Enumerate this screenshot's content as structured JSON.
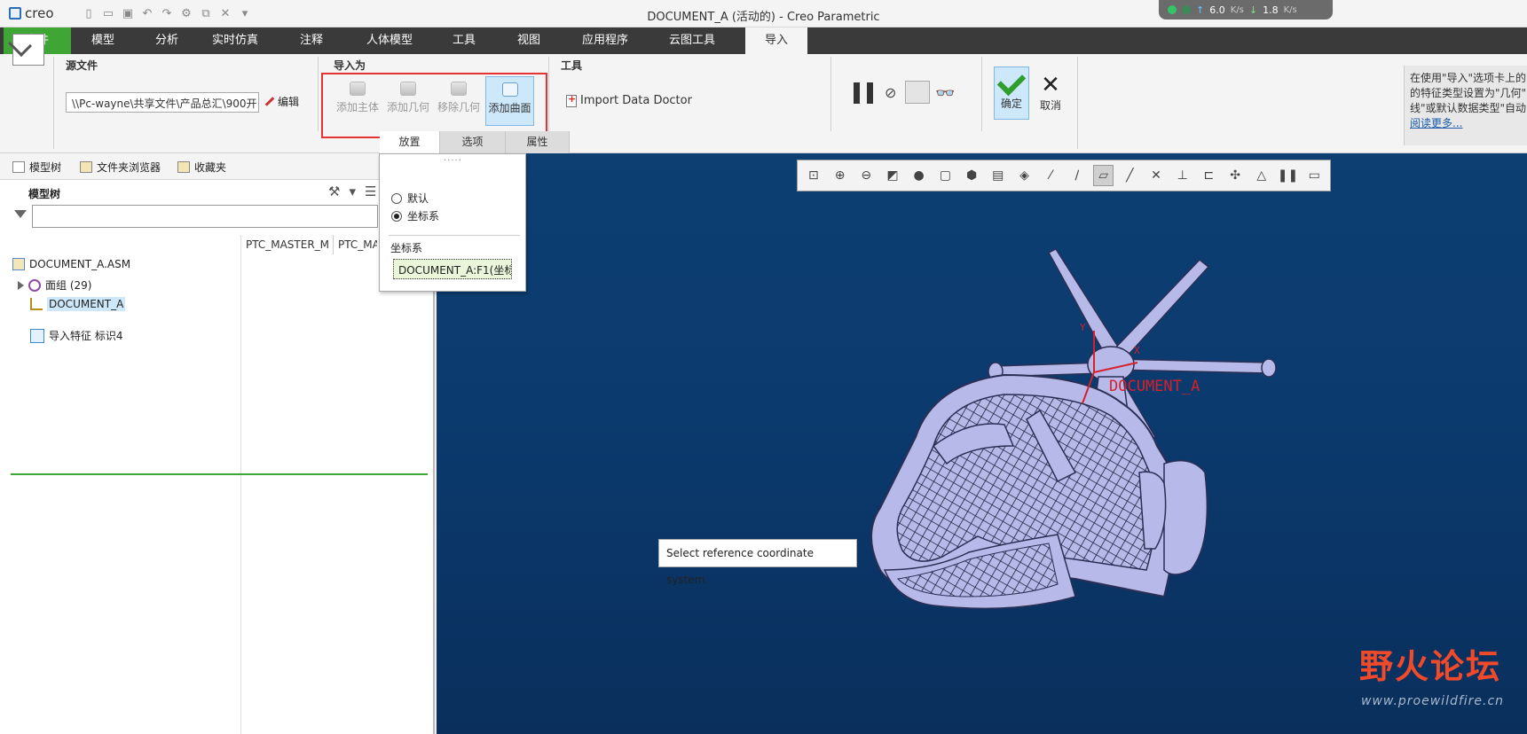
{
  "app": {
    "logo_text": "creo",
    "window_title": "DOCUMENT_A (活动的) - Creo Parametric"
  },
  "netmon": {
    "up_value": "6.0",
    "up_unit": "K/s",
    "down_value": "1.8",
    "down_unit": "K/s"
  },
  "tabs": [
    {
      "label": "文件"
    },
    {
      "label": "模型"
    },
    {
      "label": "分析"
    },
    {
      "label": "实时仿真"
    },
    {
      "label": "注释"
    },
    {
      "label": "人体模型"
    },
    {
      "label": "工具"
    },
    {
      "label": "视图"
    },
    {
      "label": "应用程序"
    },
    {
      "label": "云图工具"
    },
    {
      "label": "导入"
    }
  ],
  "ribbon": {
    "source_group_label": "源文件",
    "source_path": "\\\\Pc-wayne\\共享文件\\产品总汇\\900开",
    "edit_label": "编辑",
    "import_as_label": "导入为",
    "import_buttons": [
      {
        "label": "添加主体"
      },
      {
        "label": "添加几何"
      },
      {
        "label": "移除几何"
      },
      {
        "label": "添加曲面"
      }
    ],
    "tools_label": "工具",
    "import_data_doctor": "Import Data Doctor",
    "ok_label": "确定",
    "cancel_label": "取消",
    "help_line1": "在使用\"导入\"选项卡上的",
    "help_line2": "的特征类型设置为\"几何\"",
    "help_line3": "线\"或默认数据类型\"自动",
    "help_link": "阅读更多..."
  },
  "subtabs": [
    {
      "label": "放置"
    },
    {
      "label": "选项"
    },
    {
      "label": "属性"
    }
  ],
  "leftpanel": {
    "nav_tabs": [
      {
        "label": "模型树"
      },
      {
        "label": "文件夹浏览器"
      },
      {
        "label": "收藏夹"
      }
    ],
    "tree_header": "模型树",
    "columns": [
      {
        "label": "PTC_MASTER_M"
      },
      {
        "label": "PTC_MA"
      }
    ],
    "rows": [
      {
        "label": "DOCUMENT_A.ASM"
      },
      {
        "label": "面组 (29)"
      },
      {
        "label": "DOCUMENT_A"
      },
      {
        "label": "导入特征 标识4"
      }
    ]
  },
  "dropdown": {
    "grip": "·····",
    "option_default": "默认",
    "option_csys": "坐标系",
    "csys_label": "坐标系",
    "csys_value": "DOCUMENT_A:F1(坐标"
  },
  "viewport": {
    "tooltip": "Select reference coordinate system.",
    "csys_tag": "DOCUMENT_A",
    "csys_axis_x": "X",
    "csys_axis_y": "Y",
    "watermark_text": "野火论坛",
    "watermark_url": "www.proewildfire.cn"
  },
  "colors": {
    "file_tab": "#3fa535",
    "ribbon_dark": "#3a3a3a",
    "viewport": "#0b3a6e",
    "highlight": "#e53232",
    "csys": "#d8202a"
  }
}
